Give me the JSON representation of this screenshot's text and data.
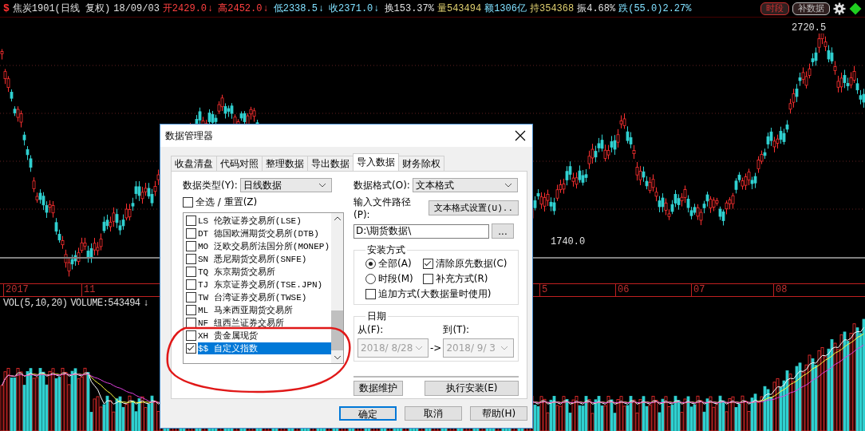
{
  "quote_bar": {
    "icon": "$",
    "title": "焦炭1901(日线 复权)",
    "date": "18/09/03",
    "fields": [
      {
        "text": "开2429.0",
        "arrow": "↓",
        "color": "#ff4040"
      },
      {
        "text": "高2452.0",
        "arrow": "↓",
        "color": "#ff4040"
      },
      {
        "text": "低2338.5",
        "arrow": "↓",
        "color": "#80e0ff"
      },
      {
        "text": "收2371.0",
        "arrow": "↓",
        "color": "#80e0ff"
      },
      {
        "text": "换153.37%",
        "color": "#e0e0e0"
      },
      {
        "text": "量543494",
        "color": "#e0d070"
      },
      {
        "text": "额1306亿",
        "color": "#80e0ff"
      },
      {
        "text": "持354368",
        "color": "#e0d070"
      },
      {
        "text": "振4.68%",
        "color": "#e0e0e0"
      },
      {
        "text": "跌(55.0)2.27%",
        "color": "#80e0ff"
      }
    ],
    "buttons": [
      {
        "label": "时段",
        "color": "#d03030"
      },
      {
        "label": "补数据",
        "color": "#c0c0c0"
      }
    ]
  },
  "price_labels": [
    "2720.5",
    "1740.0"
  ],
  "axis_labels": [
    "2017",
    "11",
    "5",
    "06",
    "07",
    "08"
  ],
  "volume": {
    "title": "VOL(5,10,20)",
    "reading": "VOLUME:543494",
    "arrow": "↓"
  },
  "dialog": {
    "title": "数据管理器",
    "tabs": [
      {
        "label": "收盘清盘",
        "selected": false
      },
      {
        "label": "代码对照",
        "selected": false
      },
      {
        "label": "整理数据",
        "selected": false
      },
      {
        "label": "导出数据",
        "selected": false
      },
      {
        "label": "导入数据",
        "selected": true
      },
      {
        "label": "财务除权",
        "selected": false
      }
    ],
    "data_type": {
      "label": "数据类型(Y):",
      "value": "日线数据"
    },
    "select_all": {
      "label": "全选 / 重置(Z)",
      "checked": false
    },
    "markets": [
      {
        "code": "LS",
        "name": "伦敦证券交易所(LSE)",
        "checked": false,
        "selected": false
      },
      {
        "code": "DT",
        "name": "德国欧洲期货交易所(DTB)",
        "checked": false,
        "selected": false
      },
      {
        "code": "MO",
        "name": "泛欧交易所法国分所(MONEP)",
        "checked": false,
        "selected": false
      },
      {
        "code": "SN",
        "name": "悉尼期货交易所(SNFE)",
        "checked": false,
        "selected": false
      },
      {
        "code": "TQ",
        "name": "东京期货交易所",
        "checked": false,
        "selected": false
      },
      {
        "code": "TJ",
        "name": "东京证券交易所(TSE.JPN)",
        "checked": false,
        "selected": false
      },
      {
        "code": "TW",
        "name": "台湾证券交易所(TWSE)",
        "checked": false,
        "selected": false
      },
      {
        "code": "ML",
        "name": "马来西亚期货交易所",
        "checked": false,
        "selected": false
      },
      {
        "code": "NF",
        "name": "纽西兰证券交易所",
        "checked": false,
        "selected": false
      },
      {
        "code": "XH",
        "name": "贵金属现货",
        "checked": false,
        "selected": false
      },
      {
        "code": "$$",
        "name": "自定义指数",
        "checked": true,
        "selected": true
      }
    ],
    "data_format": {
      "label": "数据格式(O):",
      "value": "文本格式"
    },
    "path": {
      "label": "输入文件路径(P):",
      "settings_button": "文本格式设置(U)..",
      "value": "D:\\期货数据\\",
      "browse_button": "..."
    },
    "install_mode": {
      "title": "安装方式",
      "options": [
        {
          "kind": "radio",
          "label": "全部(A)",
          "selected": true
        },
        {
          "kind": "checkbox",
          "label": "清除原先数据(C)",
          "checked": true
        },
        {
          "kind": "radio",
          "label": "时段(M)",
          "selected": false
        },
        {
          "kind": "checkbox",
          "label": "补充方式(R)",
          "checked": false
        },
        {
          "kind": "checkbox",
          "label": "追加方式(大数据量时使用)",
          "checked": false
        }
      ]
    },
    "date_range": {
      "title": "日期",
      "from_label": "从(F):",
      "from": "2018/ 8/28",
      "separator": "->",
      "to_label": "到(T):",
      "to": "2018/ 9/ 3",
      "disabled": true
    },
    "progress": {
      "level": 0
    },
    "actions": [
      "数据维护",
      "执行安装(E)"
    ],
    "buttons": [
      {
        "label": "确定",
        "default": true
      },
      {
        "label": "取消",
        "default": false
      },
      {
        "label": "帮助(H)",
        "default": false
      }
    ]
  }
}
